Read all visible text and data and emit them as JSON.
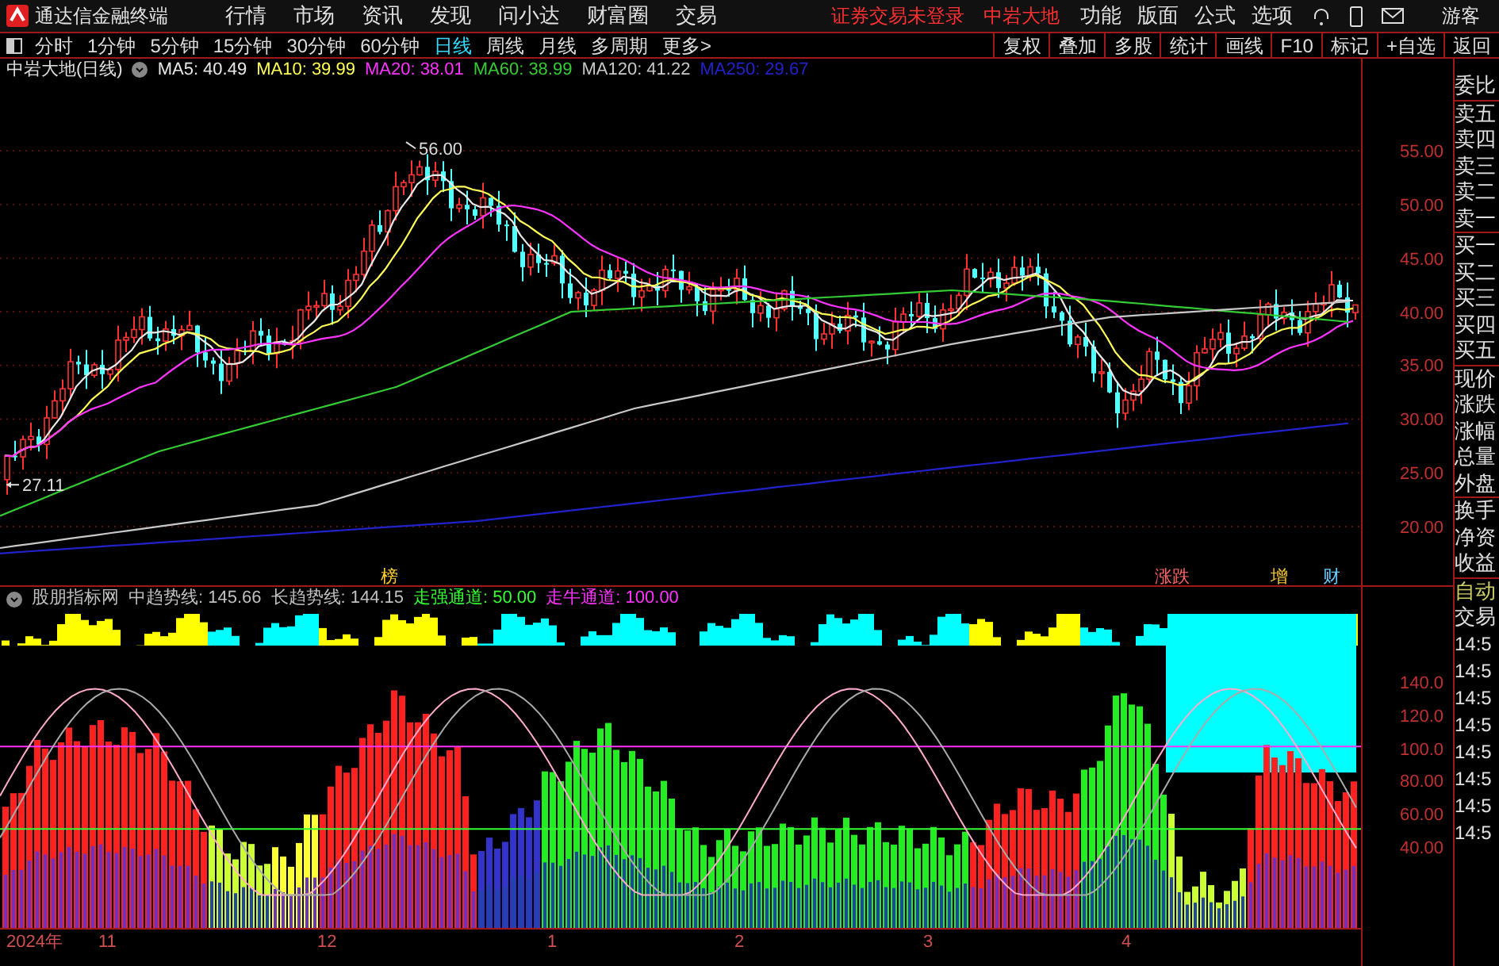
{
  "menu_bar": {
    "app_title": "通达信金融终端",
    "menu": [
      "行情",
      "市场",
      "资讯",
      "发现",
      "问小达",
      "财富圈",
      "交易"
    ],
    "login_status": "证券交易未登录",
    "stock_name": "中岩大地",
    "right_menu": [
      "功能",
      "版面",
      "公式",
      "选项"
    ],
    "user": "游客"
  },
  "toolbar": {
    "periods": [
      {
        "label": "分时",
        "selected": false
      },
      {
        "label": "1分钟",
        "selected": false
      },
      {
        "label": "5分钟",
        "selected": false
      },
      {
        "label": "15分钟",
        "selected": false
      },
      {
        "label": "30分钟",
        "selected": false
      },
      {
        "label": "60分钟",
        "selected": false
      },
      {
        "label": "日线",
        "selected": true
      },
      {
        "label": "周线",
        "selected": false
      },
      {
        "label": "月线",
        "selected": false
      },
      {
        "label": "多周期",
        "selected": false
      }
    ],
    "more": "更多>",
    "buttons": [
      "复权",
      "叠加",
      "多股",
      "统计",
      "画线",
      "F10",
      "标记",
      "+自选",
      "返回"
    ]
  },
  "price_chart": {
    "title": "中岩大地(日线)",
    "ma_legend": [
      {
        "label": "MA5: 40.49",
        "color": "#e8e8e8"
      },
      {
        "label": "MA10: 39.99",
        "color": "#ffff55"
      },
      {
        "label": "MA20: 38.01",
        "color": "#ff33ff"
      },
      {
        "label": "MA60: 38.99",
        "color": "#33cc33"
      },
      {
        "label": "MA120: 41.22",
        "color": "#c8c8c8"
      },
      {
        "label": "MA250: 29.67",
        "color": "#2222cc"
      }
    ],
    "high_label": "56.00",
    "low_label": "27.11",
    "event_marks": [
      {
        "label": "榜",
        "color": "#ffcc33"
      },
      {
        "label": "涨跌",
        "color": "#ff6666"
      },
      {
        "label": "增",
        "color": "#ffcc33"
      },
      {
        "label": "财",
        "color": "#66ccff"
      }
    ],
    "axis": [
      "55.00",
      "50.00",
      "45.00",
      "40.00",
      "35.00",
      "30.00",
      "25.00",
      "20.00"
    ]
  },
  "indicator": {
    "legend": [
      {
        "label": "股朋指标网",
        "color": "#c0c0c0"
      },
      {
        "label": "中趋势线: 145.66",
        "color": "#c0c0c0"
      },
      {
        "label": "长趋势线: 144.15",
        "color": "#c0c0c0"
      },
      {
        "label": "走强通道: 50.00",
        "color": "#33ff33"
      },
      {
        "label": "走牛通道: 100.00",
        "color": "#ff33ff"
      }
    ],
    "axis": [
      "140.0",
      "120.0",
      "100.0",
      "80.00",
      "60.00",
      "40.00"
    ]
  },
  "date_axis": [
    "2024年",
    "11",
    "12",
    "1",
    "2",
    "3",
    "4"
  ],
  "side_panel": {
    "quote_groups": [
      [
        "委比"
      ],
      [
        "卖五",
        "卖四",
        "卖三",
        "卖二",
        "卖一"
      ],
      [
        "买一",
        "买二",
        "买三",
        "买四",
        "买五"
      ],
      [
        "现价",
        "涨跌",
        "涨幅",
        "总量",
        "外盘"
      ],
      [
        "换手",
        "净资",
        "收益"
      ]
    ],
    "trade_labels": [
      {
        "label": "自动",
        "color": "#cccc66"
      },
      {
        "label": "交易",
        "color": "#e0e0e0"
      }
    ],
    "times": [
      "14:5",
      "14:5",
      "14:5",
      "14:5",
      "14:5",
      "14:5",
      "14:5",
      "14:5"
    ]
  }
}
